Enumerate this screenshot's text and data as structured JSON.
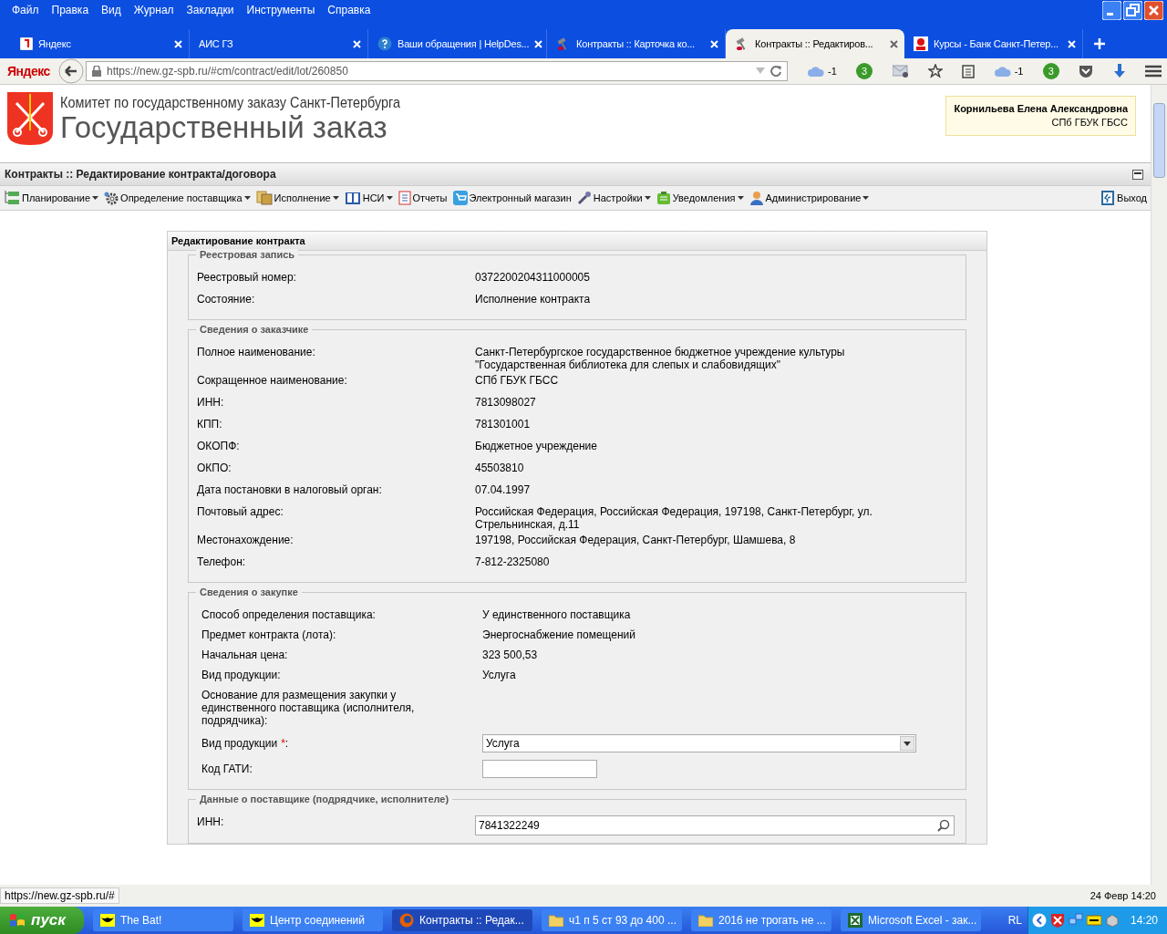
{
  "window": {
    "menu": [
      "Файл",
      "Правка",
      "Вид",
      "Журнал",
      "Закладки",
      "Инструменты",
      "Справка"
    ]
  },
  "tabs": [
    {
      "label": "Яндекс",
      "selected": false
    },
    {
      "label": "АИС ГЗ",
      "selected": false
    },
    {
      "label": "Ваши обращения | HelpDes...",
      "selected": false
    },
    {
      "label": "Контракты :: Карточка ко...",
      "selected": false
    },
    {
      "label": "Контракты :: Редактиров...",
      "selected": true
    },
    {
      "label": "Курсы - Банк Санкт-Петер...",
      "selected": false
    }
  ],
  "address_bar": {
    "brand": "Яндекс",
    "url": "https://new.gz-spb.ru/#cm/contract/edit/lot/260850"
  },
  "toolbar_badges": [
    "-1",
    "3",
    "-1",
    "3"
  ],
  "site": {
    "org": "Комитет по государственному заказу Санкт-Петербурга",
    "title": "Государственный заказ",
    "user": {
      "name": "Корнильева Елена Александровна",
      "org": "СПб ГБУК ГБСС"
    }
  },
  "panel_title": "Контракты :: Редактирование контракта/договора",
  "nav": [
    {
      "label": "Планирование",
      "dropdown": true
    },
    {
      "label": "Определение поставщика",
      "dropdown": true
    },
    {
      "label": "Исполнение",
      "dropdown": true
    },
    {
      "label": "НСИ",
      "dropdown": true
    },
    {
      "label": "Отчеты",
      "dropdown": false
    },
    {
      "label": "Электронный магазин",
      "dropdown": false
    },
    {
      "label": "Настройки",
      "dropdown": true
    },
    {
      "label": "Уведомления",
      "dropdown": true
    },
    {
      "label": "Администрирование",
      "dropdown": true
    }
  ],
  "logout": "Выход",
  "form": {
    "title": "Редактирование контракта",
    "sections": [
      {
        "legend": "Реестровая запись",
        "kind": "wide",
        "rows": [
          {
            "kind": "text",
            "label": "Реестровый номер:",
            "value": "0372200204311000005"
          },
          {
            "kind": "text",
            "label": "Состояние:",
            "value": "Исполнение контракта"
          }
        ]
      },
      {
        "legend": "Сведения о заказчике",
        "kind": "wide",
        "rows": [
          {
            "kind": "text",
            "label": "Полное наименование:",
            "value": "Санкт-Петербургское государственное бюджетное учреждение культуры \"Государственная библиотека для слепых и слабовидящих\""
          },
          {
            "kind": "text",
            "label": "Сокращенное наименование:",
            "value": "СПб ГБУК ГБСС"
          },
          {
            "kind": "text",
            "label": "ИНН:",
            "value": "7813098027"
          },
          {
            "kind": "text",
            "label": "КПП:",
            "value": "781301001"
          },
          {
            "kind": "text",
            "label": "ОКОПФ:",
            "value": "Бюджетное учреждение"
          },
          {
            "kind": "text",
            "label": "ОКПО:",
            "value": "45503810"
          },
          {
            "kind": "text",
            "label": "Дата постановки в налоговый орган:",
            "value": "07.04.1997"
          },
          {
            "kind": "text",
            "label": "Почтовый адрес:",
            "value": "Российская Федерация, Российская Федерация, 197198, Санкт-Петербург, ул. Стрельнинская, д.11"
          },
          {
            "kind": "text",
            "label": "Местонахождение:",
            "value": "197198, Российская Федерация, Санкт-Петербург, Шамшева, 8"
          },
          {
            "kind": "text",
            "label": "Телефон:",
            "value": "7-812-2325080"
          }
        ]
      },
      {
        "legend": "Сведения о закупке",
        "kind": "compact",
        "rows": [
          {
            "kind": "text",
            "label": "Способ определения поставщика:",
            "value": "У единственного поставщика"
          },
          {
            "kind": "text",
            "label": "Предмет контракта (лота):",
            "value": "Энергоснабжение помещений"
          },
          {
            "kind": "text",
            "label": "Начальная цена:",
            "value": "323 500,53"
          },
          {
            "kind": "text",
            "label": "Вид продукции:",
            "value": "Услуга"
          },
          {
            "kind": "label",
            "label": "Основание для размещения закупки у единственного поставщика (исполнителя, подрядчика):"
          },
          {
            "kind": "select",
            "label": "Вид продукции",
            "required_mark": "*",
            "colon": ":",
            "value": "Услуга"
          },
          {
            "kind": "input",
            "label": "Код ГАТИ:"
          }
        ]
      },
      {
        "legend": "Данные о поставщике (подрядчике, исполнителе)",
        "kind": "wide",
        "rows": [
          {
            "kind": "search",
            "label": "ИНН:",
            "value": "7841322249"
          }
        ]
      }
    ]
  },
  "status_bar": {
    "link": "https://new.gz-spb.ru/#",
    "date": "24 Февр 14:20"
  },
  "taskbar": {
    "start": "пуск",
    "items": [
      {
        "label": "The Bat!",
        "selected": false
      },
      {
        "label": "Центр соединений",
        "selected": false
      },
      {
        "label": "Контракты :: Редак...",
        "selected": true
      },
      {
        "label": "ч1 п 5 ст 93 до 400 ...",
        "selected": false
      },
      {
        "label": "2016 не трогать не ...",
        "selected": false
      },
      {
        "label": "Microsoft Excel - зак...",
        "selected": false
      }
    ],
    "language": "RL",
    "clock": "14:20"
  }
}
